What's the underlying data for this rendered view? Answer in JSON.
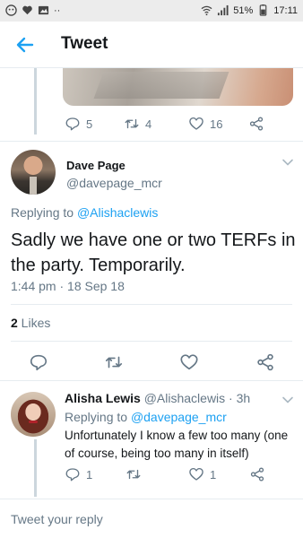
{
  "status_bar": {
    "battery": "51%",
    "time": "17:11",
    "dots": "··"
  },
  "app_bar": {
    "title": "Tweet"
  },
  "previous_tweet": {
    "reply_count": "5",
    "retweet_count": "4",
    "like_count": "16"
  },
  "main_tweet": {
    "name": "Dave Page",
    "handle": "@davepage_mcr",
    "replying_prefix": "Replying to ",
    "replying_to": "@Alishaclewis",
    "text": "Sadly we have one or two TERFs in the party. Temporarily.",
    "timestamp": "1:44 pm · 18 Sep 18",
    "likes_count": "2",
    "likes_label": " Likes"
  },
  "reply_tweet": {
    "name": "Alisha Lewis",
    "handle": "@Alishaclewis · 3h",
    "replying_prefix": "Replying to ",
    "replying_to": "@davepage_mcr",
    "text": "Unfortunately I know a few too many (one of course, being too many in itself)",
    "reply_count": "1",
    "retweet_count": "",
    "like_count": "1"
  },
  "compose": {
    "placeholder": "Tweet your reply"
  },
  "colors": {
    "accent": "#1da1f2",
    "secondary_text": "#657786",
    "primary_text": "#14171a"
  }
}
